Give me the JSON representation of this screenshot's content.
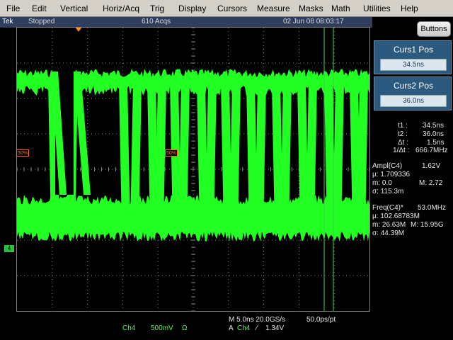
{
  "menu": [
    "File",
    "Edit",
    "Vertical",
    "Horiz/Acq",
    "Trig",
    "Display",
    "Cursors",
    "Measure",
    "Masks",
    "Math",
    "Utilities",
    "Help"
  ],
  "status": {
    "brand": "Tek",
    "state": "Stopped",
    "acqs": "610 Acqs",
    "datetime": "02 Jun 08 08:03:17"
  },
  "buttons_label": "Buttons",
  "cursor1": {
    "title": "Curs1 Pos",
    "value": "34.5ns"
  },
  "cursor2": {
    "title": "Curs2 Pos",
    "value": "36.0ns"
  },
  "cursor_readout": {
    "t1_label": "t1 :",
    "t1_value": "34.5ns",
    "t2_label": "t2 :",
    "t2_value": "36.0ns",
    "dt_label": "Δt :",
    "dt_value": "1.5ns",
    "inv_dt_label": "1/Δt :",
    "inv_dt_value": "666.7MHz"
  },
  "ampl": {
    "title": "Ampl(C4)",
    "value": "1.62V",
    "mean": "µ: 1.709336",
    "min": "m: 0.0",
    "max": "M: 2.72",
    "sigma": "σ: 115.3m"
  },
  "freq": {
    "title": "Freq(C4)*",
    "value": "53.0MHz",
    "mean": "µ: 102.68783M",
    "min": "m: 26.63M",
    "max": "M: 15.95G",
    "sigma": "σ: 44.39M"
  },
  "ref_marker_label": "50%",
  "channel_marker": "4",
  "bottom": {
    "timebase": "M 5.0ns 20.0GS/s",
    "resolution": "50.0ps/pt",
    "channel": "Ch4",
    "scale": "500mV",
    "ohm": "Ω",
    "trig_source_prefix": "A",
    "trig_channel": "Ch4",
    "trig_slope": "⁄",
    "trig_level": "1.34V"
  },
  "colors": {
    "trace": "#22ff22",
    "grid": "#808080",
    "cursor": "#3fcf4f",
    "status_bg": "#2f3e5c",
    "curs_box": "#2c5a7e"
  },
  "icons": [
    "trigger-position-marker-icon",
    "channel-ground-marker-icon"
  ]
}
